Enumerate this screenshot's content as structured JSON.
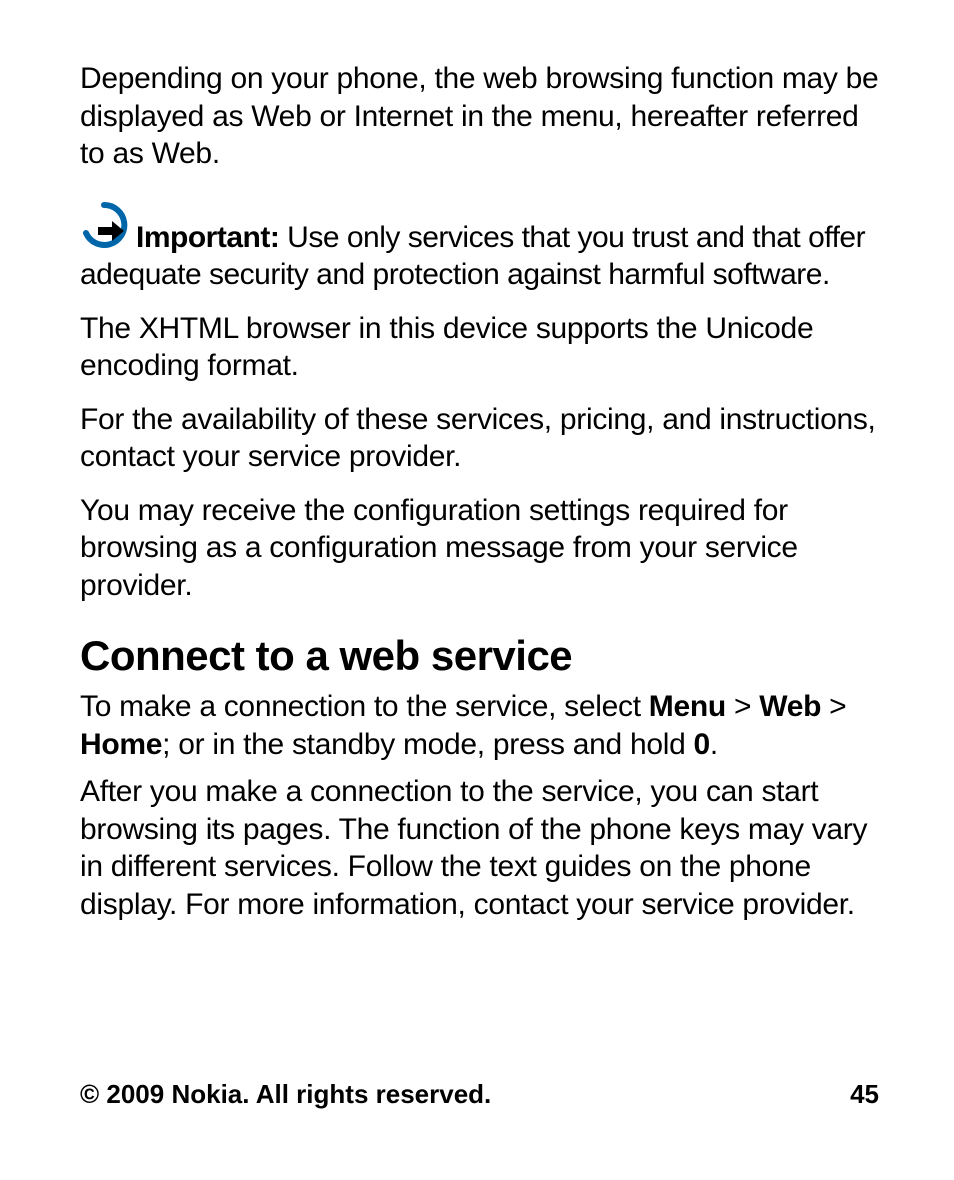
{
  "intro": "Depending on your phone, the web browsing function may be displayed as Web or Internet in the menu, hereafter referred to as Web.",
  "important": {
    "label": "Important:",
    "text": "Use only services that you trust and that offer adequate security and protection against harmful software."
  },
  "para2": "The XHTML browser in this device supports the Unicode encoding format.",
  "para3": "For the availability of these services, pricing, and instructions, contact your service provider.",
  "para4": "You may receive the configuration settings required for browsing as a configuration message from your service provider.",
  "heading": "Connect to a web service",
  "connect": {
    "pre": "To make a connection to the service, select ",
    "menu": "Menu",
    "sep1": " > ",
    "web": "Web",
    "sep2": " > ",
    "home": "Home",
    "mid": "; or in the standby mode, press and hold ",
    "zero": "0",
    "end": "."
  },
  "para5": "After you make a connection to the service, you can start browsing its pages. The function of the phone keys may vary in different services. Follow the text guides on the phone display. For more information, contact your service provider.",
  "footer": {
    "copyright": "© 2009 Nokia. All rights reserved.",
    "page": "45"
  }
}
